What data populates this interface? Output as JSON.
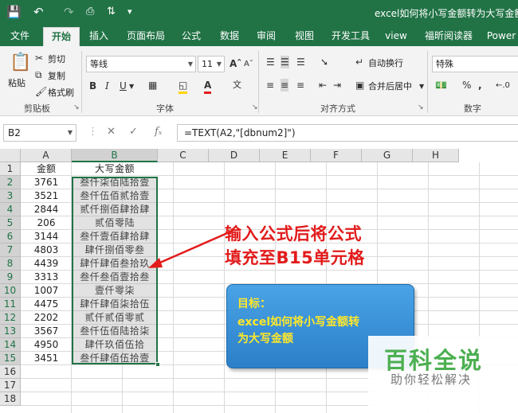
{
  "titlebar": {
    "title": "excel如何将小写金额转为大写金额"
  },
  "tabs": [
    "文件",
    "开始",
    "插入",
    "页面布局",
    "公式",
    "数据",
    "审阅",
    "视图",
    "开发工具",
    "view",
    "福昕阅读器",
    "Power"
  ],
  "active_tab": "开始",
  "ribbon": {
    "paste": "粘贴",
    "cut": "剪切",
    "copy": "复制",
    "format_painter": "格式刷",
    "clipboard_group": "剪贴板",
    "font_name": "等线",
    "font_size": "11",
    "font_group": "字体",
    "wrap_text": "自动换行",
    "merge_center": "合并后居中",
    "alignment_group": "对齐方式",
    "number_format": "特殊",
    "number_group": "数字"
  },
  "formula_bar": {
    "name_box": "B2",
    "formula": "=TEXT(A2,\"[dbnum2]\")"
  },
  "columns": [
    "A",
    "B",
    "C",
    "D",
    "E",
    "F",
    "G",
    "H"
  ],
  "rows": [
    "1",
    "2",
    "3",
    "4",
    "5",
    "6",
    "7",
    "8",
    "9",
    "10",
    "11",
    "12",
    "13",
    "14",
    "15",
    "16",
    "17",
    "18"
  ],
  "headers": {
    "a": "金额",
    "b": "大写金额"
  },
  "table": [
    {
      "a": "3761",
      "b": "叁仟柒佰陆拾壹"
    },
    {
      "a": "3521",
      "b": "叁仟伍佰贰拾壹"
    },
    {
      "a": "2844",
      "b": "贰仟捌佰肆拾肆"
    },
    {
      "a": "206",
      "b": "贰佰零陆"
    },
    {
      "a": "3144",
      "b": "叁仟壹佰肆拾肆"
    },
    {
      "a": "4803",
      "b": "肆仟捌佰零叁"
    },
    {
      "a": "4439",
      "b": "肆仟肆佰叁拾玖"
    },
    {
      "a": "3313",
      "b": "叁仟叁佰壹拾叁"
    },
    {
      "a": "1007",
      "b": "壹仟零柒"
    },
    {
      "a": "4475",
      "b": "肆仟肆佰柒拾伍"
    },
    {
      "a": "2202",
      "b": "贰仟贰佰零贰"
    },
    {
      "a": "3567",
      "b": "叁仟伍佰陆拾柒"
    },
    {
      "a": "4950",
      "b": "肆仟玖佰伍拾"
    },
    {
      "a": "3451",
      "b": "叁仟肆佰伍拾壹"
    }
  ],
  "annotation": {
    "line1": "输入公式后将公式",
    "line2": "填充至B15单元格"
  },
  "goal_box": {
    "line1": "目标：",
    "line2": "excel如何将小写金额转",
    "line3": "为大写金额"
  },
  "watermark": {
    "brand": "百科全说",
    "slogan": "助你轻松解决"
  },
  "colors": {
    "accent": "#217346",
    "annotation": "#e21b1b",
    "goal_bg": "#3b8fd9",
    "goal_text": "#ffe82a",
    "watermark": "#4caf50"
  }
}
